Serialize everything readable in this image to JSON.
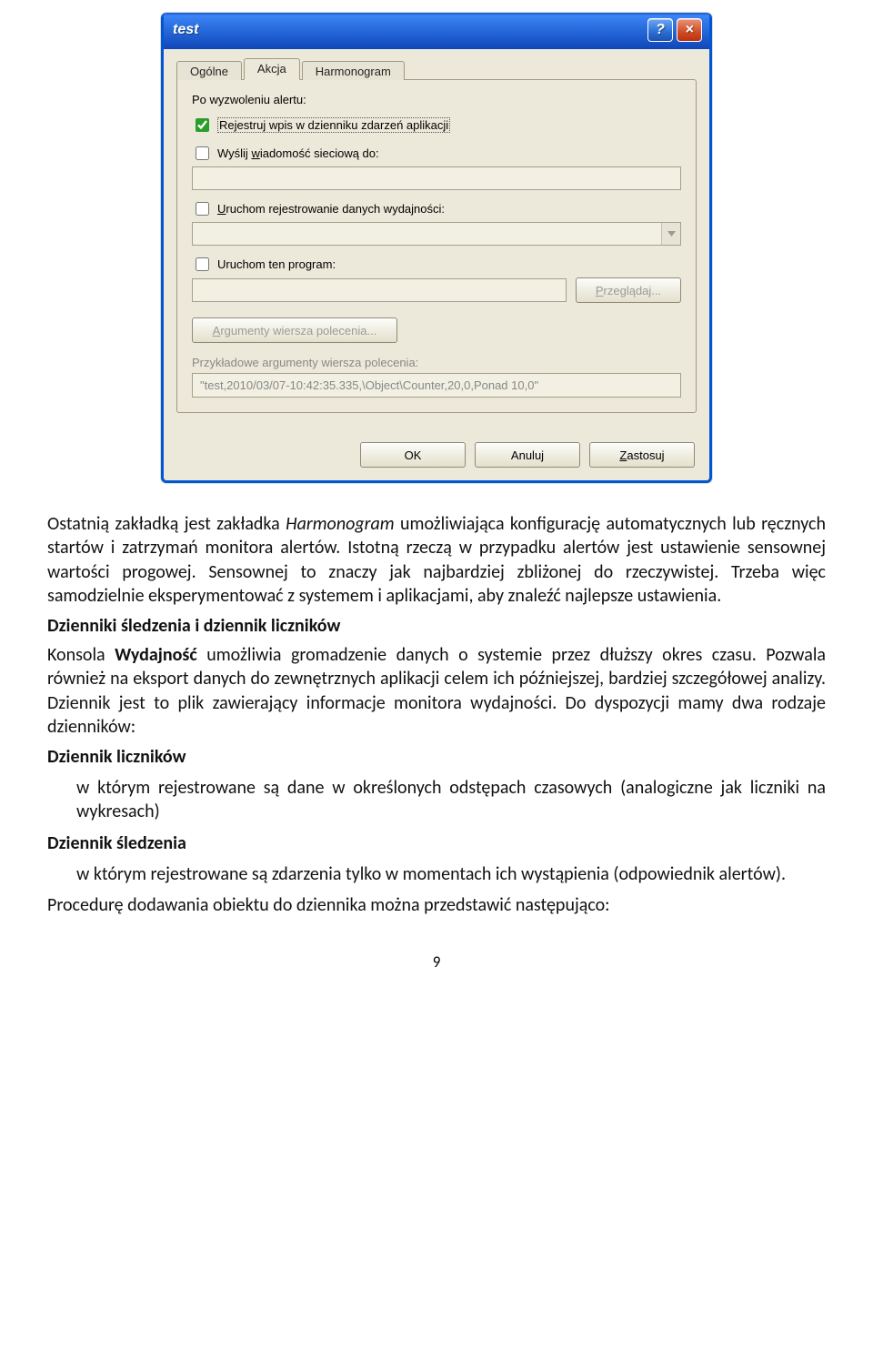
{
  "dialog": {
    "title": "test",
    "help_btn": "?",
    "close_btn": "×",
    "tabs": {
      "general": "Ogólne",
      "action": "Akcja",
      "schedule": "Harmonogram"
    },
    "panel": {
      "heading": "Po wyzwoleniu alertu:",
      "check_log": "Rejestruj wpis w dzienniku zdarzeń aplikacji",
      "check_netmsg": "Wyślij wiadomość sieciową do:",
      "netmsg_value": "",
      "check_perflog": "Uruchom rejestrowanie danych wydajności:",
      "perflog_value": "",
      "check_program": "Uruchom ten program:",
      "program_value": "",
      "browse_btn": "Przeglądaj...",
      "args_btn": "Argumenty wiersza polecenia...",
      "example_label": "Przykładowe argumenty wiersza polecenia:",
      "example_value": "\"test,2010/03/07-10:42:35.335,\\Object\\Counter,20,0,Ponad 10,0\""
    },
    "footer": {
      "ok": "OK",
      "cancel": "Anuluj",
      "apply": "Zastosuj"
    }
  },
  "doc": {
    "p1a": "Ostatnią zakładką jest zakładka ",
    "p1b": "Harmonogram",
    "p1c": " umożliwiająca konfigurację automatycznych lub ręcznych startów i zatrzymań monitora alertów. Istotną rzeczą w przypadku alertów jest ustawienie sensownej wartości progowej. Sensownej to znaczy jak najbardziej zbliżonej do rzeczywistej. Trzeba więc samodzielnie eksperymentować z systemem i aplikacjami, aby znaleźć najlepsze ustawienia.",
    "h1": "Dzienniki śledzenia i dziennik liczników",
    "p2a": "Konsola ",
    "p2b": "Wydajność",
    "p2c": " umożliwia gromadzenie danych o systemie przez dłuższy okres czasu. Pozwala również na eksport danych do zewnętrznych aplikacji celem ich późniejszej, bardziej szczegółowej analizy. Dziennik jest to plik zawierający informacje monitora wydajności. Do dyspozycji mamy dwa rodzaje dzienników:",
    "i1": "Dziennik liczników",
    "i1d": "w którym rejestrowane są dane w określonych odstępach czasowych (analogiczne jak liczniki na wykresach)",
    "i2": "Dziennik śledzenia",
    "i2d": "w którym rejestrowane są zdarzenia tylko w momentach ich wystąpienia (odpowiednik alertów).",
    "p3": "Procedurę dodawania obiektu do dziennika można przedstawić następująco:",
    "page_num": "9"
  }
}
